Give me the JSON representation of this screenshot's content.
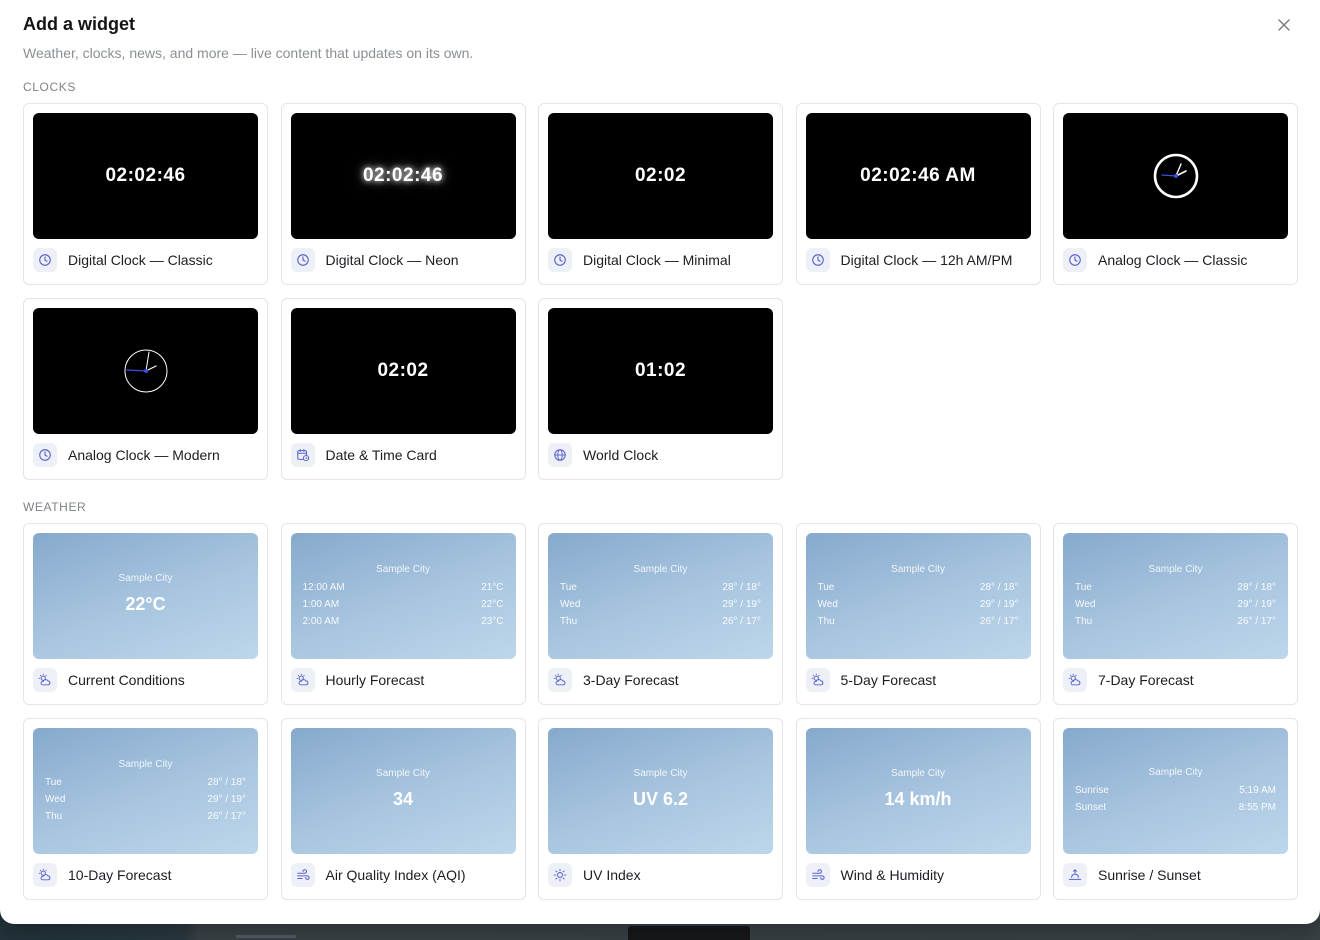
{
  "dialog": {
    "title": "Add a widget",
    "subtitle": "Weather, clocks, news, and more — live content that updates on its own."
  },
  "sections": {
    "clocks": {
      "label": "CLOCKS",
      "cards": [
        {
          "label": "Digital Clock — Classic",
          "preview": "02:02:46",
          "icon": "clock-icon"
        },
        {
          "label": "Digital Clock — Neon",
          "preview": "02:02:46",
          "icon": "clock-icon"
        },
        {
          "label": "Digital Clock — Minimal",
          "preview": "02:02",
          "icon": "clock-icon"
        },
        {
          "label": "Digital Clock — 12h AM/PM",
          "preview": "02:02:46 AM",
          "icon": "clock-icon"
        },
        {
          "label": "Analog Clock — Classic",
          "icon": "clock-icon"
        },
        {
          "label": "Analog Clock — Modern",
          "icon": "clock-icon"
        },
        {
          "label": "Date & Time Card",
          "preview": "02:02",
          "icon": "calendar-clock-icon"
        },
        {
          "label": "World Clock",
          "preview": "01:02",
          "icon": "globe-icon"
        }
      ]
    },
    "weather": {
      "label": "WEATHER",
      "city": "Sample City",
      "cards": [
        {
          "label": "Current Conditions",
          "big": "22°C",
          "icon": "sun-cloud-icon"
        },
        {
          "label": "Hourly Forecast",
          "icon": "sun-cloud-icon",
          "rows": [
            {
              "k": "12:00 AM",
              "v": "21°C"
            },
            {
              "k": "1:00 AM",
              "v": "22°C"
            },
            {
              "k": "2:00 AM",
              "v": "23°C"
            }
          ]
        },
        {
          "label": "3-Day Forecast",
          "icon": "sun-cloud-icon",
          "rows": [
            {
              "k": "Tue",
              "v": "28° / 18°"
            },
            {
              "k": "Wed",
              "v": "29° / 19°"
            },
            {
              "k": "Thu",
              "v": "26° / 17°"
            }
          ]
        },
        {
          "label": "5-Day Forecast",
          "icon": "sun-cloud-icon",
          "rows": [
            {
              "k": "Tue",
              "v": "28° / 18°"
            },
            {
              "k": "Wed",
              "v": "29° / 19°"
            },
            {
              "k": "Thu",
              "v": "26° / 17°"
            }
          ]
        },
        {
          "label": "7-Day Forecast",
          "icon": "sun-cloud-icon",
          "rows": [
            {
              "k": "Tue",
              "v": "28° / 18°"
            },
            {
              "k": "Wed",
              "v": "29° / 19°"
            },
            {
              "k": "Thu",
              "v": "26° / 17°"
            }
          ]
        },
        {
          "label": "10-Day Forecast",
          "icon": "sun-cloud-icon",
          "rows": [
            {
              "k": "Tue",
              "v": "28° / 18°"
            },
            {
              "k": "Wed",
              "v": "29° / 19°"
            },
            {
              "k": "Thu",
              "v": "26° / 17°"
            }
          ]
        },
        {
          "label": "Air Quality Index (AQI)",
          "big": "34",
          "icon": "wind-icon"
        },
        {
          "label": "UV Index",
          "big": "UV 6.2",
          "icon": "sun-icon"
        },
        {
          "label": "Wind & Humidity",
          "big": "14 km/h",
          "icon": "wind-icon"
        },
        {
          "label": "Sunrise / Sunset",
          "icon": "sunrise-icon",
          "rows": [
            {
              "k": "Sunrise",
              "v": "5:19 AM"
            },
            {
              "k": "Sunset",
              "v": "8:55 PM"
            }
          ]
        }
      ]
    }
  },
  "colors": {
    "icon_accent": "#5b63c9",
    "icon_chip_bg": "#eef0f8",
    "card_border": "#e3e5e8",
    "clock_hand_accent": "#3b4fe0"
  }
}
